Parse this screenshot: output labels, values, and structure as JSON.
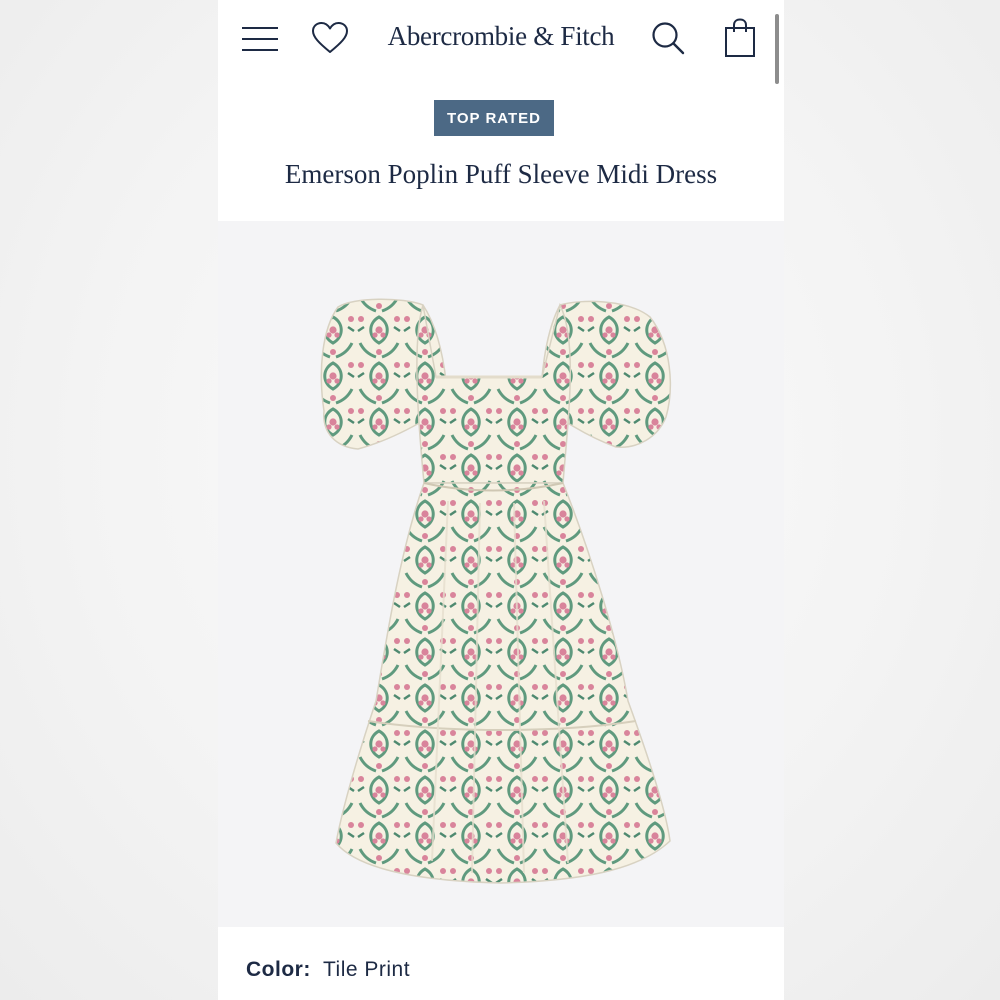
{
  "header": {
    "brand": "Abercrombie & Fitch",
    "icons": {
      "menu": "hamburger-menu-icon",
      "favorites": "heart-icon",
      "search": "search-icon",
      "bag": "shopping-bag-icon"
    }
  },
  "product": {
    "badge": "TOP RATED",
    "title": "Emerson Poplin Puff Sleeve Midi Dress",
    "image_alt": "Floral tile print puff sleeve midi dress",
    "color_label": "Color:",
    "color_value": "Tile Print"
  },
  "colors": {
    "brand_navy": "#1d2a44",
    "badge_bg": "#4c6985",
    "print_green": "#5f9a7e",
    "print_pink": "#d9849b",
    "fabric_cream": "#f6f1e3"
  }
}
